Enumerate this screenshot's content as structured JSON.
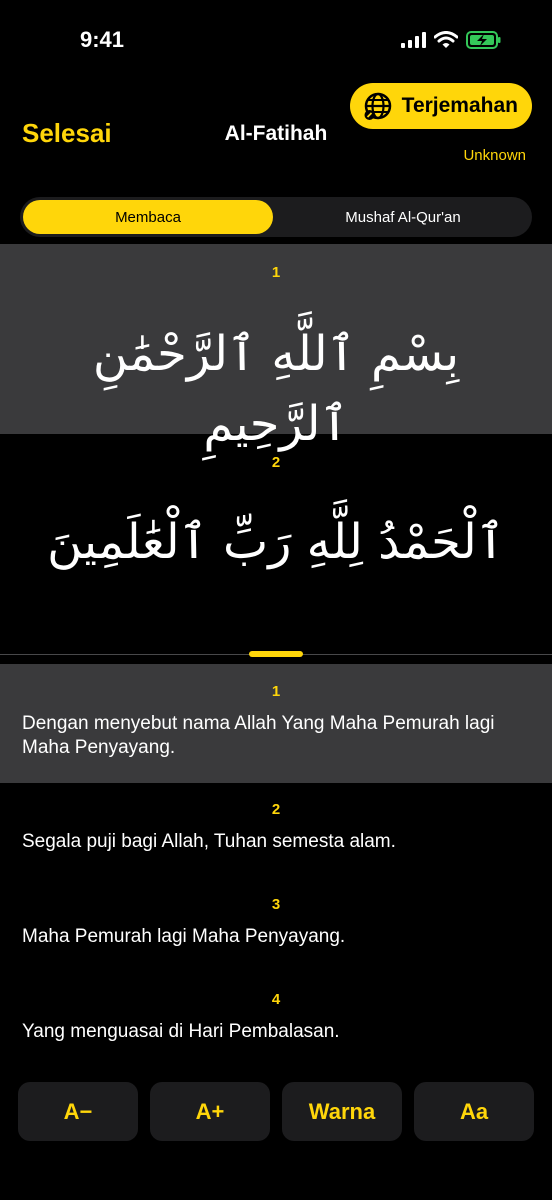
{
  "status_bar": {
    "time": "9:41"
  },
  "nav": {
    "done_label": "Selesai",
    "title": "Al-Fatihah",
    "translation_button": "Terjemahan",
    "translator": "Unknown"
  },
  "segment": {
    "options": [
      "Membaca",
      "Mushaf Al-Qur'an"
    ],
    "selected": "Membaca"
  },
  "arabic": [
    {
      "number": "1",
      "text": "بِسْمِ ٱللَّهِ ٱلرَّحْمَٰنِ ٱلرَّحِيمِ"
    },
    {
      "number": "2",
      "text": "ٱلْحَمْدُ لِلَّهِ رَبِّ ٱلْعَٰلَمِينَ"
    }
  ],
  "translations": [
    {
      "number": "1",
      "text": "Dengan menyebut nama Allah Yang Maha Pemurah lagi Maha Penyayang."
    },
    {
      "number": "2",
      "text": "Segala puji bagi Allah, Tuhan semesta alam."
    },
    {
      "number": "3",
      "text": "Maha Pemurah lagi Maha Penyayang."
    },
    {
      "number": "4",
      "text": "Yang menguasai di Hari Pembalasan."
    }
  ],
  "controls": {
    "decrease": "A−",
    "increase": "A+",
    "color": "Warna",
    "font": "Aa"
  },
  "colors": {
    "accent": "#FFD60A",
    "background": "#000000",
    "highlight": "#3A3A3C",
    "battery": "#34C759"
  }
}
